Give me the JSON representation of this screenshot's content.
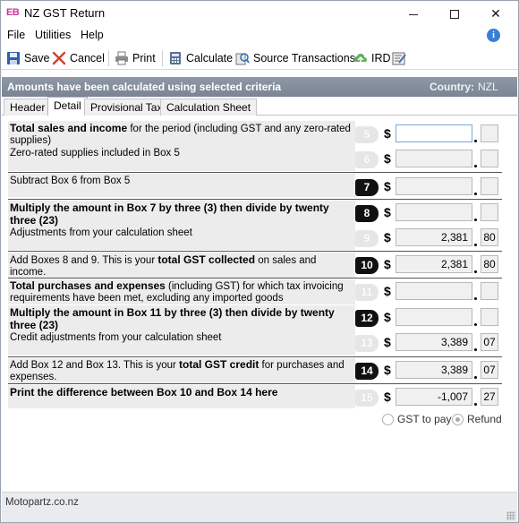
{
  "window": {
    "app_icon_text": "EB",
    "title": "NZ GST Return",
    "minimize_glyph": "—",
    "maximize_glyph": "□",
    "close_glyph": "✕"
  },
  "menu": {
    "file": "File",
    "utilities": "Utilities",
    "help": "Help",
    "info_glyph": "i"
  },
  "toolbar": {
    "save": "Save",
    "cancel": "Cancel",
    "print": "Print",
    "calculate": "Calculate",
    "source_transactions": "Source Transactions",
    "ird": "IRD"
  },
  "banner": {
    "message": "Amounts have been calculated using selected criteria",
    "country_label": "Country:",
    "country_value": "NZL"
  },
  "tabs": [
    "Header",
    "Detail",
    "Provisional Tax",
    "Calculation Sheet"
  ],
  "form": {
    "currency_symbol": "$",
    "rows": {
      "r5": {
        "bold": "Total sales and income",
        "rest": " for the period (including GST and any zero-rated supplies)",
        "box": "5",
        "amount": "",
        "cents": ""
      },
      "r6": {
        "bold": "",
        "rest": "Zero-rated supplies included in Box 5",
        "box": "6",
        "amount": "",
        "cents": ""
      },
      "r7": {
        "bold": "",
        "rest": "Subtract Box 6 from Box 5",
        "box": "7",
        "amount": "",
        "cents": ""
      },
      "r8": {
        "bold": "Multiply the amount in Box 7 by three (3) then divide by twenty three (23)",
        "rest": "",
        "box": "8",
        "amount": "",
        "cents": ""
      },
      "r9": {
        "bold": "",
        "rest": "Adjustments from your calculation sheet",
        "box": "9",
        "amount": "2,381",
        "cents": "80"
      },
      "r10": {
        "pre": "Add Boxes 8 and 9. This is your ",
        "bold": "total GST collected",
        "rest": " on sales and income.",
        "box": "10",
        "amount": "2,381",
        "cents": "80"
      },
      "r11": {
        "bold": "Total purchases and expenses",
        "rest": " (including GST) for which tax invoicing requirements have been met, excluding any imported goods",
        "box": "11",
        "amount": "",
        "cents": ""
      },
      "r12": {
        "bold": "Multiply the amount in Box 11 by three (3) then divide by twenty three (23)",
        "rest": "",
        "box": "12",
        "amount": "",
        "cents": ""
      },
      "r13": {
        "bold": "",
        "rest": "Credit adjustments from your calculation sheet",
        "box": "13",
        "amount": "3,389",
        "cents": "07"
      },
      "r14": {
        "pre": "Add Box 12 and Box 13. This is your ",
        "bold": "total GST credit",
        "rest": " for purchases and expenses.",
        "box": "14",
        "amount": "3,389",
        "cents": "07"
      },
      "r15": {
        "bold": "Print the difference between Box 10 and Box 14 here",
        "rest": "",
        "box": "15",
        "amount": "-1,007",
        "cents": "27"
      }
    },
    "radio_gst_to_pay": "GST to pay",
    "radio_refund": "Refund",
    "selected_option": "Refund"
  },
  "status": {
    "text": "Motopartz.co.nz"
  }
}
